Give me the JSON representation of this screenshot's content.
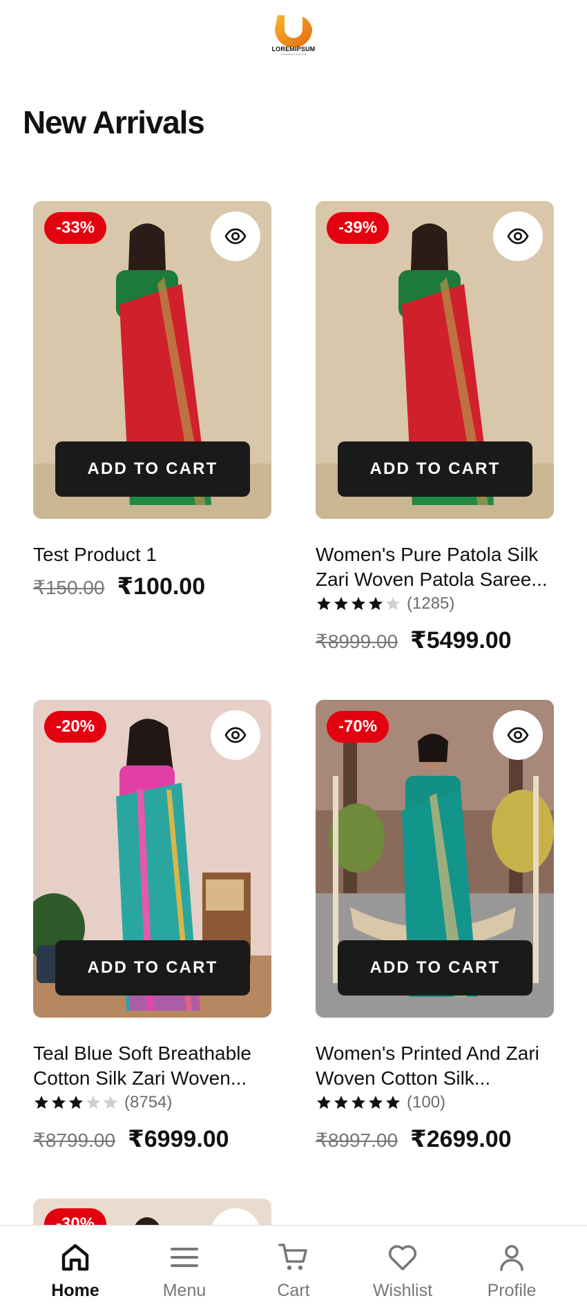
{
  "brand": {
    "name": "LOREMIPSUM",
    "tagline": "YOURSLOGAN"
  },
  "section": {
    "title": "New Arrivals"
  },
  "products": [
    {
      "discount": "-33%",
      "cart_label": "ADD TO CART",
      "name": "Test Product 1",
      "rating": null,
      "reviews": null,
      "old_price": "₹150.00",
      "new_price": "₹100.00"
    },
    {
      "discount": "-39%",
      "cart_label": "ADD TO CART",
      "name": "Women's Pure Patola Silk Zari Woven Patola Saree...",
      "name_line1": "Women's Pure Patola Silk",
      "name_line2": "Zari Woven Patola Saree...",
      "rating": 4,
      "reviews": "(1285)",
      "old_price": "₹8999.00",
      "new_price": "₹5499.00"
    },
    {
      "discount": "-20%",
      "cart_label": "ADD TO CART",
      "name": "Teal Blue Soft Breathable Cotton Silk Zari Woven...",
      "name_line1": "Teal Blue Soft Breathable",
      "name_line2": "Cotton Silk Zari Woven...",
      "rating": 3,
      "reviews": "(8754)",
      "old_price": "₹8799.00",
      "new_price": "₹6999.00"
    },
    {
      "discount": "-70%",
      "cart_label": "ADD TO CART",
      "name": "Women's Printed And Zari Woven Cotton Silk...",
      "name_line1": "Women's Printed And Zari",
      "name_line2": "Woven Cotton Silk...",
      "rating": 5,
      "reviews": "(100)",
      "old_price": "₹8997.00",
      "new_price": "₹2699.00"
    }
  ],
  "partial_product": {
    "discount": "-30%"
  },
  "nav": [
    {
      "label": "Home",
      "icon": "home-icon",
      "active": true
    },
    {
      "label": "Menu",
      "icon": "menu-icon",
      "active": false
    },
    {
      "label": "Cart",
      "icon": "cart-icon",
      "active": false
    },
    {
      "label": "Wishlist",
      "icon": "heart-icon",
      "active": false
    },
    {
      "label": "Profile",
      "icon": "user-icon",
      "active": false
    }
  ],
  "colors": {
    "badge": "#e3000f",
    "button": "#1a1a1a",
    "logo_orange": "#f39a1c"
  }
}
